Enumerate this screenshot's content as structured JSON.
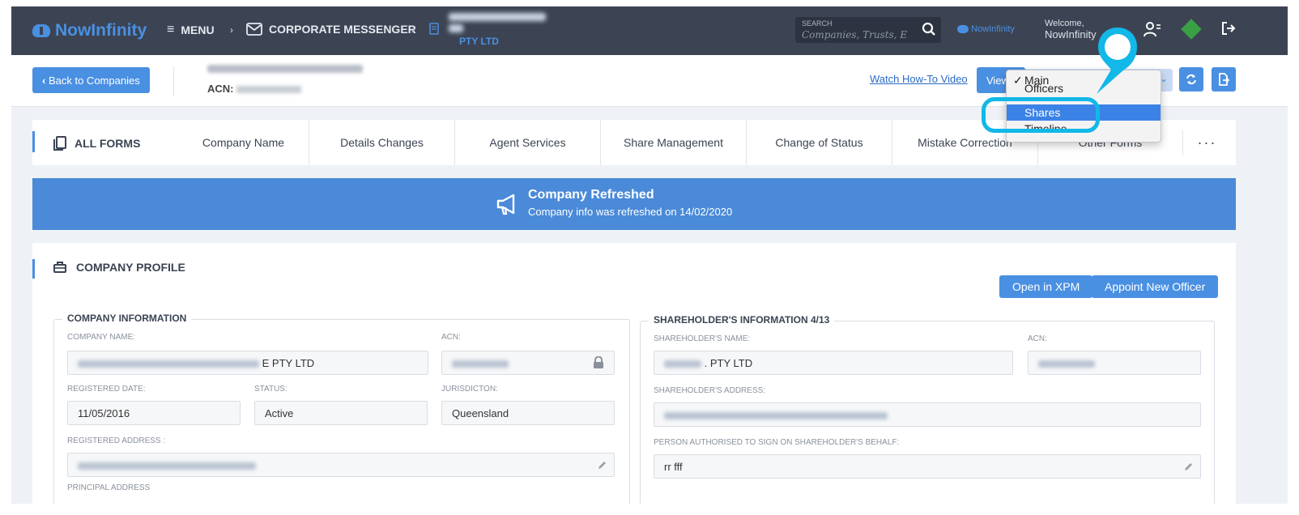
{
  "app": {
    "logo_text": "NowInfinity",
    "menu_label": "MENU",
    "corporate_messenger_label": "CORPORATE MESSENGER",
    "company_crumb_suffix": "PTY LTD",
    "search_label": "SEARCH",
    "search_placeholder": "Companies, Trusts, E",
    "mini_logo_text": "NowInfinity",
    "welcome_label": "Welcome,",
    "welcome_user": "NowInfinity"
  },
  "subbar": {
    "back_label": "Back to Companies",
    "acn_label": "ACN:",
    "watch_video": "Watch How-To Video",
    "view_label": "View"
  },
  "view_dropdown": {
    "options": [
      "Main",
      "Officers",
      "Shares",
      "Timeline"
    ],
    "checked": "Main",
    "highlighted": "Shares"
  },
  "forms": {
    "all_forms_label": "ALL FORMS",
    "tabs": [
      "Company Name",
      "Details Changes",
      "Agent Services",
      "Share Management",
      "Change of Status",
      "Mistake Correction",
      "Other Forms"
    ],
    "more": "···"
  },
  "banner": {
    "title": "Company Refreshed",
    "subtitle": "Company info was refreshed on 14/02/2020"
  },
  "profile": {
    "title": "COMPANY PROFILE",
    "open_xpm": "Open in XPM",
    "appoint_officer": "Appoint New Officer",
    "company_info": {
      "legend": "COMPANY INFORMATION",
      "company_name_label": "COMPANY NAME:",
      "company_name_suffix": "E PTY LTD",
      "acn_label": "ACN:",
      "registered_date_label": "REGISTERED DATE:",
      "registered_date": "11/05/2016",
      "status_label": "STATUS:",
      "status": "Active",
      "jurisdiction_label": "JURISDICTON:",
      "jurisdiction": "Queensland",
      "registered_address_label": "REGISTERED ADDRESS :",
      "principal_address_label": "PRINCIPAL ADDRESS"
    },
    "shareholder_info": {
      "legend": "SHAREHOLDER'S INFORMATION 4/13",
      "name_label": "SHAREHOLDER'S NAME:",
      "name_suffix": ". PTY LTD",
      "acn_label": "ACN:",
      "address_label": "SHAREHOLDER'S ADDRESS:",
      "signer_label": "PERSON AUTHORISED TO SIGN ON SHAREHOLDER'S BEHALF:",
      "signer": "rr fff"
    }
  },
  "colors": {
    "topbar": "#3c4454",
    "accent": "#4a90e2",
    "banner": "#4a8ad8",
    "highlight_ring": "#11b8e8"
  }
}
